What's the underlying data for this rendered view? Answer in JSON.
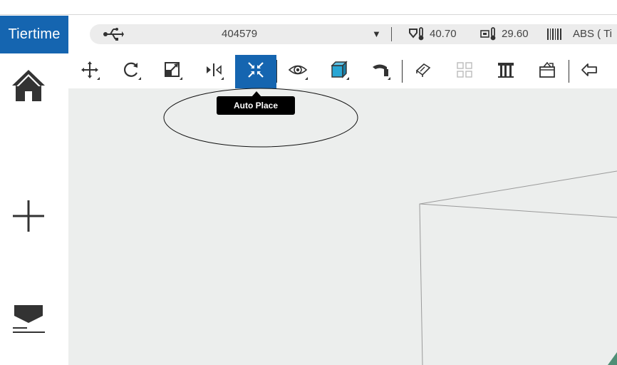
{
  "app": {
    "brand": "Tiertime",
    "accent_color": "#1565b0"
  },
  "status": {
    "connection_icon": "usb-icon",
    "printer_serial": "404579",
    "dropdown_caret": "▼",
    "nozzle_icon": "nozzle-thermometer-icon",
    "nozzle_temperature": "40.70",
    "bed_icon": "bed-thermometer-icon",
    "bed_temperature": "29.60",
    "material_icon": "barcode-icon",
    "material": "ABS ( Ti"
  },
  "toolbar": {
    "tools": [
      {
        "name": "move",
        "icon": "move-icon"
      },
      {
        "name": "rotate",
        "icon": "rotate-icon"
      },
      {
        "name": "scale",
        "icon": "scale-icon"
      },
      {
        "name": "mirror",
        "icon": "mirror-icon"
      },
      {
        "name": "auto-place",
        "icon": "auto-place-icon",
        "active": true
      },
      {
        "name": "view",
        "icon": "eye-icon"
      },
      {
        "name": "display-mode",
        "icon": "cube-icon"
      },
      {
        "name": "repair",
        "icon": "repair-icon"
      },
      {
        "name": "layout",
        "icon": "layout-icon"
      },
      {
        "name": "grid",
        "icon": "grid-icon"
      },
      {
        "name": "support",
        "icon": "support-icon"
      },
      {
        "name": "save-project",
        "icon": "box-icon"
      },
      {
        "name": "undo",
        "icon": "undo-icon"
      }
    ],
    "active_tooltip": "Auto Place"
  },
  "sidebar": {
    "items": [
      {
        "name": "home",
        "icon": "home-icon"
      },
      {
        "name": "add",
        "icon": "plus-icon"
      },
      {
        "name": "print",
        "icon": "print-icon"
      }
    ]
  }
}
